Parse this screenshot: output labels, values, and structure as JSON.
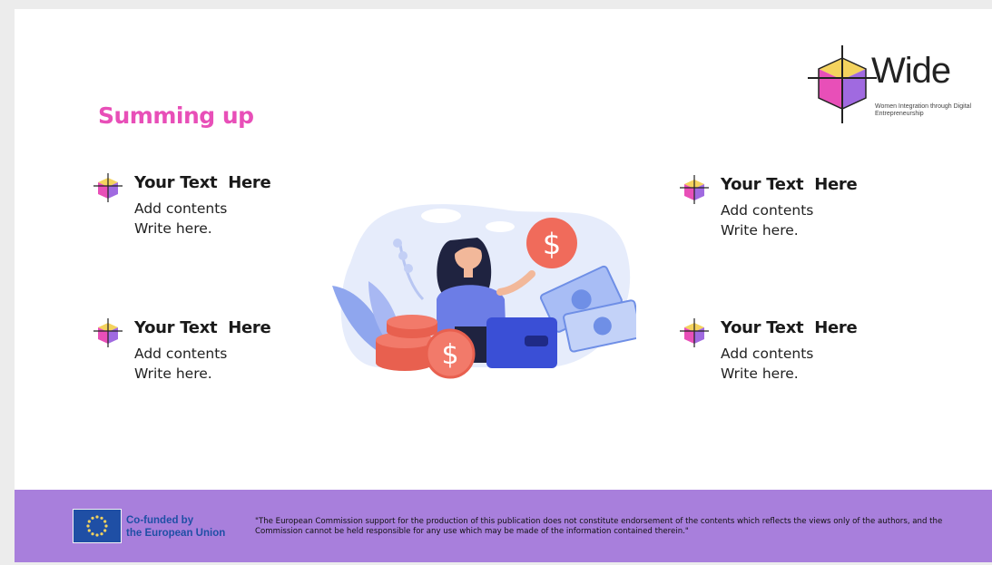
{
  "slide": {
    "title": "Summing up",
    "logo": {
      "word": "Wide",
      "subtitle": "Women Integration through Digital Entrepreneurship"
    },
    "items": [
      {
        "heading": "Your Text  Here",
        "line1": "Add contents",
        "line2": "Write here."
      },
      {
        "heading": "Your Text  Here",
        "line1": "Add contents",
        "line2": "Write here."
      },
      {
        "heading": "Your Text  Here",
        "line1": "Add contents",
        "line2": "Write here."
      },
      {
        "heading": "Your Text  Here",
        "line1": "Add contents",
        "line2": "Write here."
      }
    ],
    "illustration": {
      "icon": "woman-with-money-illustration"
    },
    "footer": {
      "eu_label_line1": "Co-funded by",
      "eu_label_line2": "the European Union",
      "disclaimer": "\"The European Commission support for the production of this publication does not constitute endorsement of the contents which reflects the views only of the authors, and the Commission cannot be held responsible for any use which may be made of the information contained therein.\""
    }
  },
  "colors": {
    "title": "#e84fb8",
    "footer_bg": "#a87fdc",
    "eu_blue": "#1f4fa5",
    "cube_pink": "#e84fb8",
    "cube_purple": "#a06ae0",
    "cube_yellow": "#f4d35e"
  }
}
